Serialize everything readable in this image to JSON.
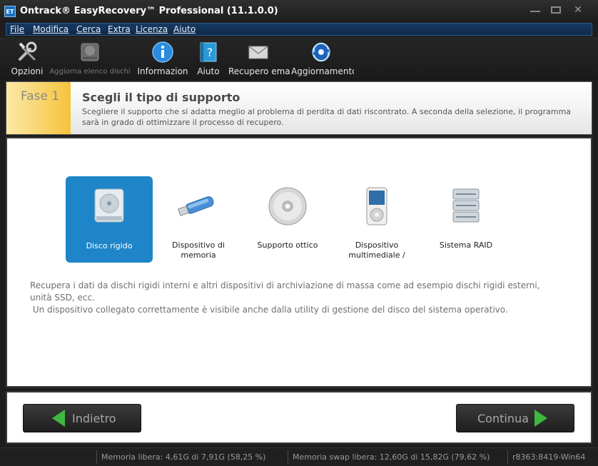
{
  "window": {
    "title": "Ontrack® EasyRecovery™ Professional (11.1.0.0)",
    "icon_text": "ET"
  },
  "menu": [
    "File",
    "Modifica",
    "Cerca",
    "Extra",
    "Licenza",
    "Aiuto"
  ],
  "toolbar": {
    "items": [
      {
        "label": "Opzioni",
        "icon": "tools-icon"
      },
      {
        "label": "Aggiorna elenco dischi",
        "icon": "drive-refresh-icon"
      },
      {
        "label": "Informazion",
        "icon": "info-icon"
      },
      {
        "label": "Aiuto",
        "icon": "help-book-icon"
      },
      {
        "label": "Recupero ema",
        "icon": "email-icon"
      },
      {
        "label": "Aggiornamento",
        "icon": "update-globe-icon"
      }
    ]
  },
  "step": {
    "number_label": "Fase 1",
    "title": "Scegli il tipo di supporto",
    "description": "Scegliere il supporto che si adatta meglio al problema di perdita di dati riscontrato. A seconda della selezione, il programma sarà in grado di ottimizzare il processo di recupero."
  },
  "media_options": [
    {
      "label": "Disco rigido",
      "icon": "hard-disk-icon",
      "selected": true
    },
    {
      "label": "Dispositivo di memoria",
      "icon": "usb-stick-icon",
      "selected": false
    },
    {
      "label": "Supporto ottico",
      "icon": "optical-disc-icon",
      "selected": false
    },
    {
      "label": "Dispositivo multimediale /",
      "icon": "media-player-icon",
      "selected": false
    },
    {
      "label": "Sistema RAID",
      "icon": "raid-icon",
      "selected": false
    }
  ],
  "selection_description": {
    "line1": "Recupera i dati da dischi rigidi interni e altri dispositivi di archiviazione di massa come ad esempio dischi rigidi esterni, unità SSD, ecc.",
    "line2": " Un dispositivo collegato correttamente è visibile anche dalla utility di gestione del disco del sistema operativo."
  },
  "navigation": {
    "back_label": "Indietro",
    "next_label": "Continua"
  },
  "status_bar": {
    "free_memory": "Memoria libera: 4,61G di 7,91G (58,25 %)",
    "free_swap": "Memoria swap libera: 12,60G di 15,82G (79,62 %)",
    "build": "r8363:8419-Win64"
  },
  "colors": {
    "accent_selected": "#1e86c8",
    "arrow_green": "#3fb83f",
    "step_badge": "#f5c33b"
  }
}
